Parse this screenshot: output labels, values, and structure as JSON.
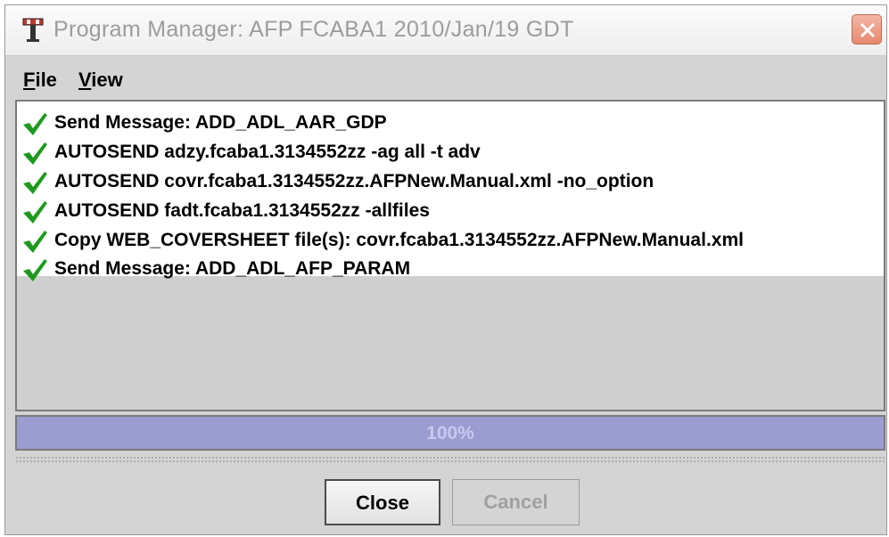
{
  "window": {
    "title": "Program Manager: AFP FCABA1 2010/Jan/19 GDT"
  },
  "menu": {
    "file_prefix": "F",
    "file_rest": "ile",
    "view_prefix": "V",
    "view_rest": "iew"
  },
  "steps": [
    {
      "label": "Send Message: ADD_ADL_AAR_GDP",
      "status": "done",
      "icon": "checkmark-icon"
    },
    {
      "label": "AUTOSEND adzy.fcaba1.3134552zz -ag all -t adv",
      "status": "done",
      "icon": "checkmark-icon"
    },
    {
      "label": "AUTOSEND covr.fcaba1.3134552zz.AFPNew.Manual.xml -no_option",
      "status": "done",
      "icon": "checkmark-icon"
    },
    {
      "label": "AUTOSEND fadt.fcaba1.3134552zz -allfiles",
      "status": "done",
      "icon": "checkmark-icon"
    },
    {
      "label": "Copy WEB_COVERSHEET file(s): covr.fcaba1.3134552zz.AFPNew.Manual.xml",
      "status": "done",
      "icon": "checkmark-icon"
    },
    {
      "label": "Send Message: ADD_ADL_AFP_PARAM",
      "status": "done",
      "icon": "checkmark-icon"
    }
  ],
  "progress": {
    "value": 1.0,
    "label": "100%"
  },
  "buttons": {
    "close": "Close",
    "cancel": "Cancel"
  },
  "colors": {
    "progress_fill": "#9b9cd0",
    "checkmark": "#1e9a1e",
    "close_x": "#e6886e"
  }
}
